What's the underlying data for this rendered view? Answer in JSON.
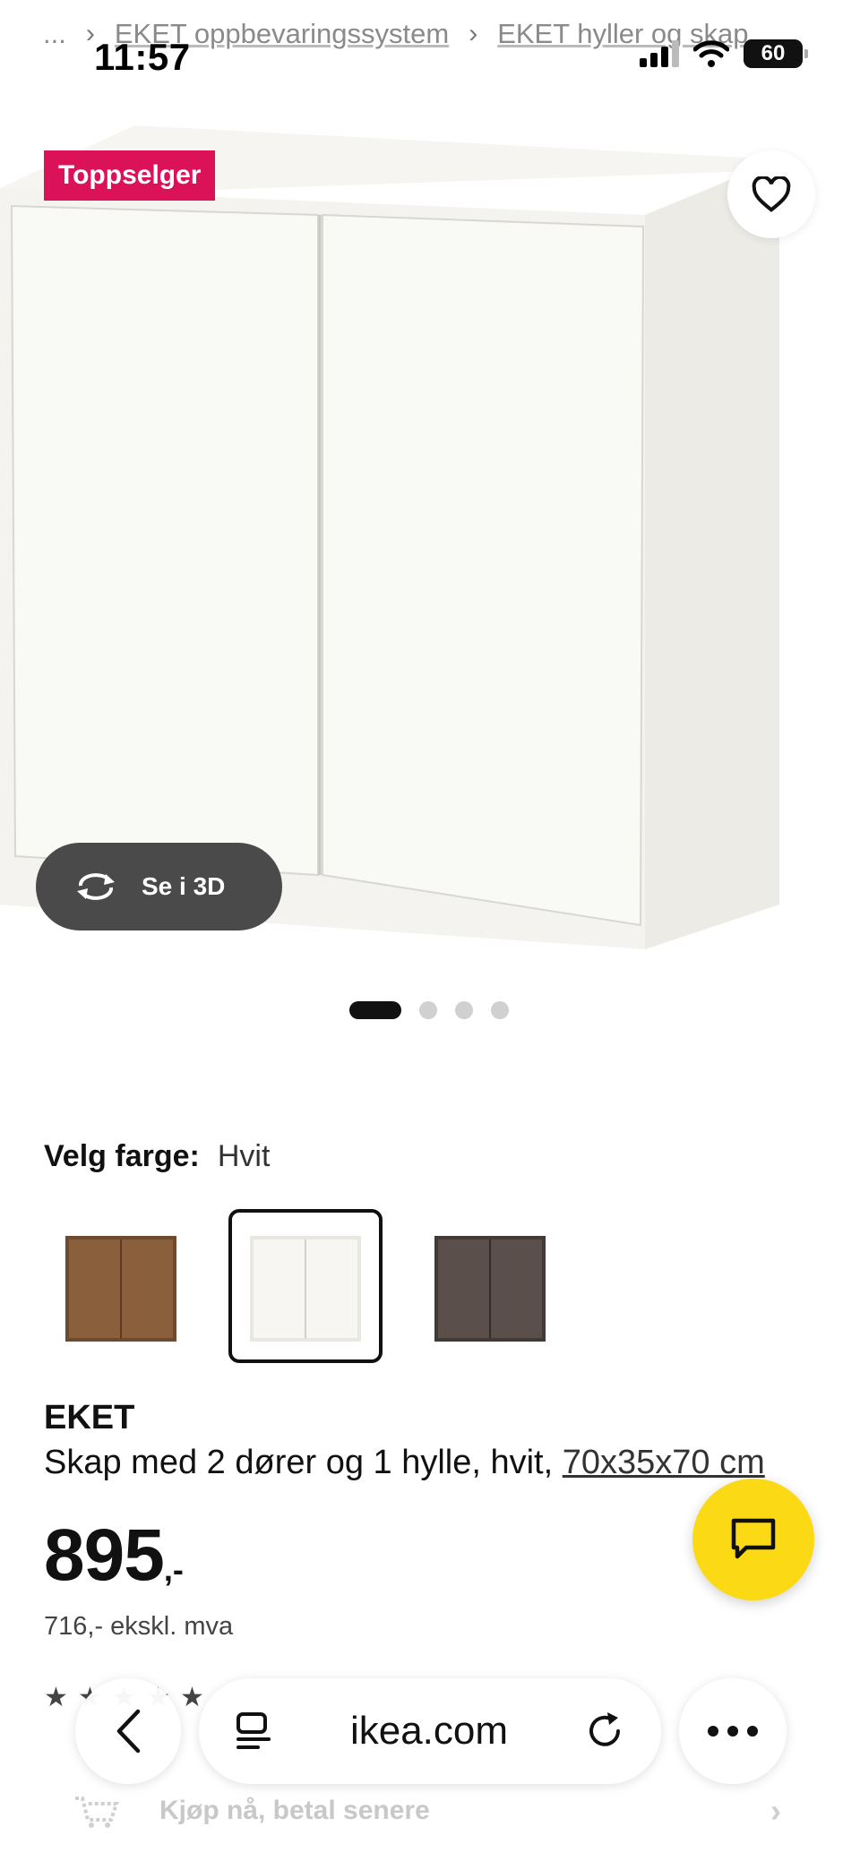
{
  "breadcrumb": {
    "ellipsis": "...",
    "items": [
      "EKET oppbevaringssystem",
      "EKET hyller og skap"
    ]
  },
  "status_bar": {
    "time": "11:57",
    "battery": "60"
  },
  "product_image": {
    "badge": "Toppselger",
    "view_3d_label": "Se i 3D",
    "carousel_count": 4,
    "carousel_active_index": 0
  },
  "color_selection": {
    "label": "Velg farge:",
    "value": "Hvit",
    "options": [
      {
        "name": "walnut",
        "color": "#8a5f3c"
      },
      {
        "name": "white",
        "color": "#f4f3ee",
        "selected": true
      },
      {
        "name": "dark-grey",
        "color": "#5a4f4b"
      }
    ]
  },
  "product": {
    "name": "EKET",
    "description": "Skap med 2 dører og 1 hylle, hvit,",
    "dimensions": "70x35x70 cm",
    "price": "895",
    "price_suffix": ",-",
    "price_ex_vat": "716,- ekskl. mva",
    "rating_stars": 5
  },
  "payment": {
    "label": "Kjøp nå, betal senere"
  },
  "browser": {
    "url": "ikea.com"
  },
  "colors": {
    "badge": "#dc1259",
    "chat_fab": "#fbd914",
    "view_3d_bg": "#4a4a4a"
  }
}
